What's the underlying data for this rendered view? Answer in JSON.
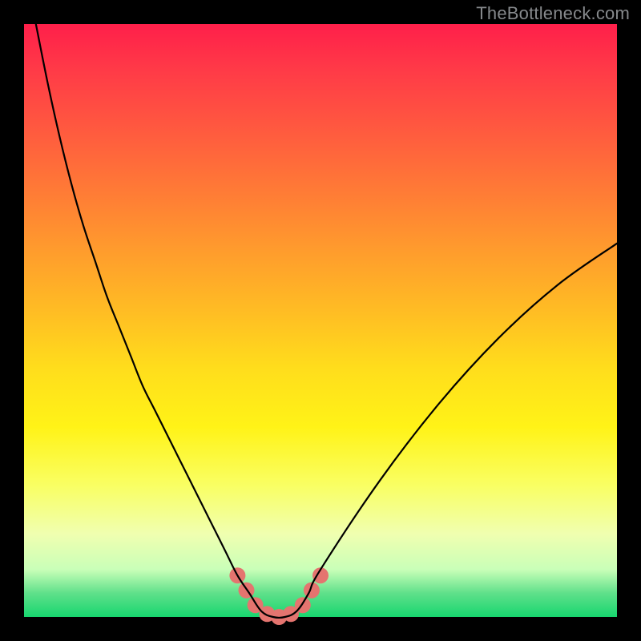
{
  "watermark": "TheBottleneck.com",
  "chart_data": {
    "type": "line",
    "title": "",
    "xlabel": "",
    "ylabel": "",
    "xlim": [
      0,
      100
    ],
    "ylim": [
      0,
      100
    ],
    "grid": false,
    "legend": false,
    "series": [
      {
        "name": "bottleneck-curve",
        "x": [
          2,
          4,
          6,
          8,
          10,
          12,
          14,
          16,
          18,
          20,
          22,
          24,
          26,
          28,
          30,
          32,
          34,
          36,
          38,
          40,
          42,
          44,
          46,
          48,
          50,
          60,
          70,
          80,
          90,
          100
        ],
        "y": [
          100,
          90,
          81,
          73,
          66,
          60,
          54,
          49,
          44,
          39,
          35,
          31,
          27,
          23,
          19,
          15,
          11,
          7,
          4,
          1,
          0,
          0,
          1,
          4,
          8,
          23,
          36,
          47,
          56,
          63
        ]
      }
    ],
    "markers": {
      "name": "highlight-dots",
      "color": "#e4746f",
      "radius_px": 10,
      "points": [
        {
          "x": 36,
          "y": 7
        },
        {
          "x": 37.5,
          "y": 4.5
        },
        {
          "x": 39,
          "y": 2
        },
        {
          "x": 41,
          "y": 0.5
        },
        {
          "x": 43,
          "y": 0
        },
        {
          "x": 45,
          "y": 0.5
        },
        {
          "x": 47,
          "y": 2
        },
        {
          "x": 48.5,
          "y": 4.5
        },
        {
          "x": 50,
          "y": 7
        }
      ]
    }
  }
}
